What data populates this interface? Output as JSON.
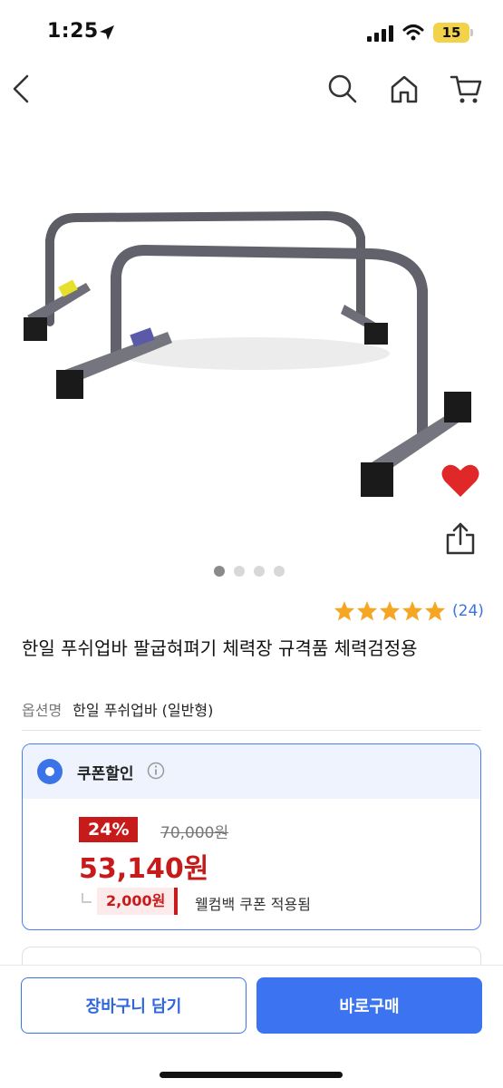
{
  "status_bar": {
    "time": "1:25",
    "battery": "15"
  },
  "product": {
    "review_count": "(24)",
    "title": "한일 푸쉬업바 팔굽혀펴기 체력장 규격품 체력검정용",
    "option_label": "옵션명",
    "option_value": "한일 푸쉬업바 (일반형)"
  },
  "coupon": {
    "label": "쿠폰할인",
    "discount": "24%",
    "original_price": "70,000원",
    "final_price": "53,140원",
    "coupon_amount": "2,000원",
    "coupon_desc": "웰컴백 쿠폰 적용됨"
  },
  "bottom_bar": {
    "cart_label": "장바구니 담기",
    "buy_label": "바로구매"
  },
  "carousel": {
    "total": 4,
    "active": 1
  },
  "rating": {
    "stars": 5,
    "max": 5
  },
  "colors": {
    "accent": "#3b73f0",
    "sale_red": "#c71a1a",
    "star": "#f5a623",
    "heart": "#e02828"
  }
}
